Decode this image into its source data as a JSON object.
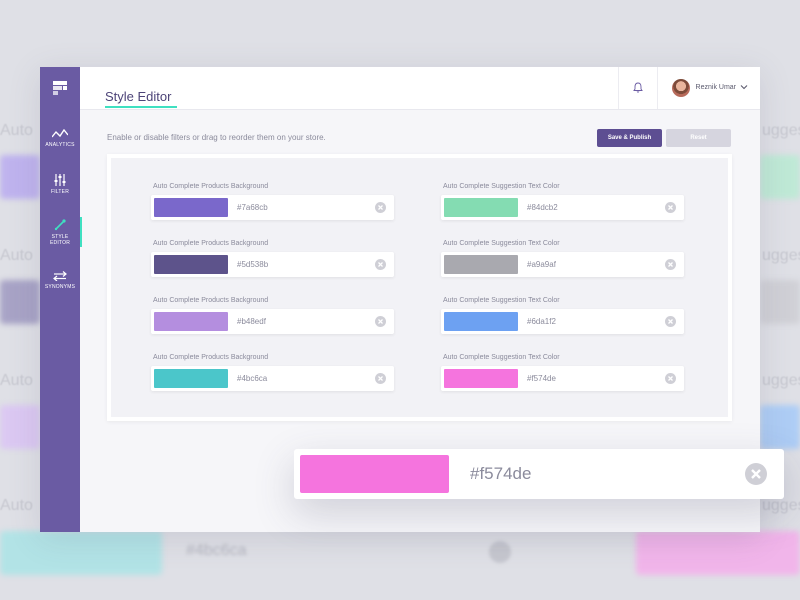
{
  "background": {
    "left_labels": [
      "Auto",
      "Auto",
      "Auto",
      "Auto",
      "Auto"
    ],
    "right_labels": [
      "ugges",
      "ugges",
      "ugges",
      "ugges",
      "ugges"
    ],
    "bottom_hex": "#4bc6ca"
  },
  "sidebar": {
    "items": [
      {
        "label": "ANALYTICS",
        "icon": "analytics-icon"
      },
      {
        "label": "FILTER",
        "icon": "filter-icon"
      },
      {
        "label": "STYLE EDITOR",
        "icon": "style-editor-icon",
        "active": true
      },
      {
        "label": "SYNONYMS",
        "icon": "synonyms-icon"
      }
    ]
  },
  "header": {
    "title": "Style Editor",
    "user_name": "Reznik Umar"
  },
  "instructions": "Enable or disable filters or drag to reorder them on your store.",
  "buttons": {
    "save": "Save & Publish",
    "reset": "Reset"
  },
  "fields_left": [
    {
      "label": "Auto Complete Products Background",
      "hex": "#7a68cb",
      "color": "#7a68cb"
    },
    {
      "label": "Auto Complete Products Background",
      "hex": "#5d538b",
      "color": "#5d538b"
    },
    {
      "label": "Auto Complete Products Background",
      "hex": "#b48edf",
      "color": "#b48edf"
    },
    {
      "label": "Auto Complete Products Background",
      "hex": "#4bc6ca",
      "color": "#4bc6ca"
    }
  ],
  "fields_right": [
    {
      "label": "Auto Complete Suggestion Text Color",
      "hex": "#84dcb2",
      "color": "#84dcb2"
    },
    {
      "label": "Auto Complete Suggestion Text Color",
      "hex": "#a9a9af",
      "color": "#a9a9af"
    },
    {
      "label": "Auto Complete Suggestion Text Color",
      "hex": "#6da1f2",
      "color": "#6da1f2"
    },
    {
      "label": "Auto Complete Suggestion Text Color",
      "hex": "#f574de",
      "color": "#f574de"
    }
  ],
  "zoomed_field": {
    "hex": "#f574de",
    "color": "#f574de"
  },
  "colors": {
    "sidebar": "#6a5ba3",
    "accent": "#3fe0c1",
    "primary_button": "#5d4e92"
  }
}
